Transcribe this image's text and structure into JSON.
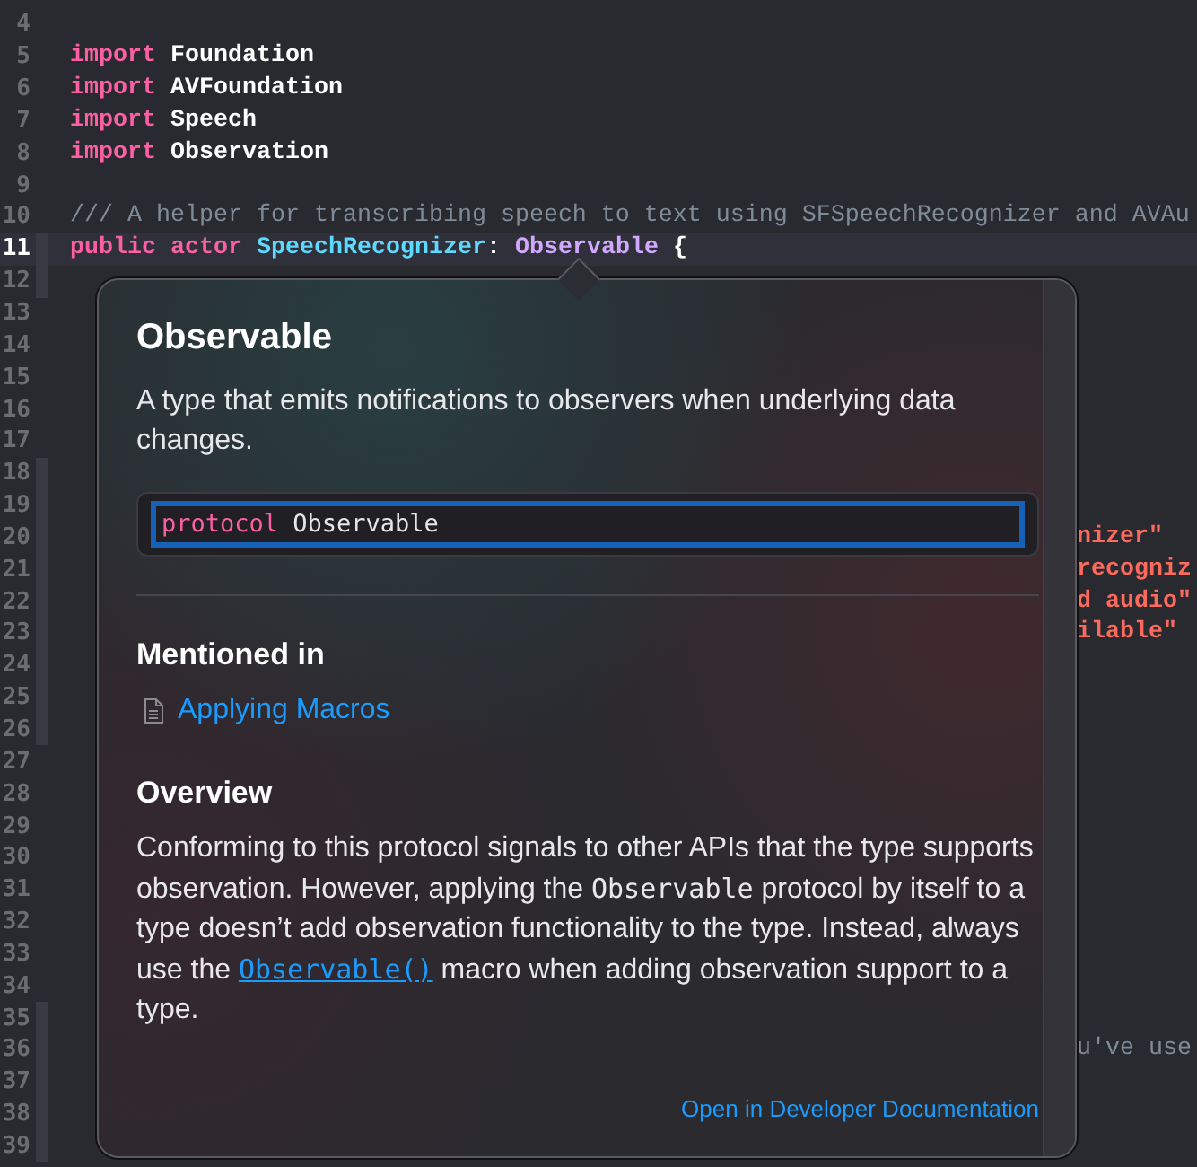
{
  "editor": {
    "lines": [
      {
        "number": "4",
        "current": false,
        "ribbon": false
      },
      {
        "number": "5",
        "current": false,
        "ribbon": false,
        "tokens": [
          {
            "kind": "keyword",
            "text": "import"
          },
          {
            "kind": "type",
            "text": " Foundation"
          }
        ]
      },
      {
        "number": "6",
        "current": false,
        "ribbon": false,
        "tokens": [
          {
            "kind": "keyword",
            "text": "import"
          },
          {
            "kind": "type",
            "text": " AVFoundation"
          }
        ]
      },
      {
        "number": "7",
        "current": false,
        "ribbon": false,
        "tokens": [
          {
            "kind": "keyword",
            "text": "import"
          },
          {
            "kind": "type",
            "text": " Speech"
          }
        ]
      },
      {
        "number": "8",
        "current": false,
        "ribbon": false,
        "tokens": [
          {
            "kind": "keyword",
            "text": "import"
          },
          {
            "kind": "type",
            "text": " Observation"
          }
        ]
      },
      {
        "number": "9",
        "current": false,
        "ribbon": false
      },
      {
        "number": "10",
        "current": false,
        "ribbon": false,
        "tokens": [
          {
            "kind": "comment",
            "text": "/// A helper for transcribing speech to text using SFSpeechRecognizer and AVAu"
          }
        ]
      },
      {
        "number": "11",
        "current": true,
        "ribbon": true,
        "tokens": [
          {
            "kind": "keyword",
            "text": "public"
          },
          {
            "kind": "keyword",
            "text": " actor"
          },
          {
            "kind": "decl",
            "text": " SpeechRecognizer"
          },
          {
            "kind": "plain",
            "text": ":"
          },
          {
            "kind": "ref",
            "text": " Observable"
          },
          {
            "kind": "plain",
            "text": " {"
          }
        ]
      },
      {
        "number": "12",
        "current": false,
        "ribbon": true
      },
      {
        "number": "13",
        "current": false,
        "ribbon": false
      },
      {
        "number": "14",
        "current": false,
        "ribbon": false
      },
      {
        "number": "15",
        "current": false,
        "ribbon": false
      },
      {
        "number": "16",
        "current": false,
        "ribbon": false
      },
      {
        "number": "17",
        "current": false,
        "ribbon": false
      },
      {
        "number": "18",
        "current": false,
        "ribbon": true
      },
      {
        "number": "19",
        "current": false,
        "ribbon": true
      },
      {
        "number": "20",
        "current": false,
        "ribbon": true,
        "tail": {
          "kind": "string",
          "text": "nizer\""
        }
      },
      {
        "number": "21",
        "current": false,
        "ribbon": true,
        "tail": {
          "kind": "string",
          "text": "recogniz"
        }
      },
      {
        "number": "22",
        "current": false,
        "ribbon": true,
        "tail": {
          "kind": "string",
          "text": "d audio\""
        }
      },
      {
        "number": "23",
        "current": false,
        "ribbon": true,
        "tail": {
          "kind": "string",
          "text": "ilable\""
        }
      },
      {
        "number": "24",
        "current": false,
        "ribbon": true
      },
      {
        "number": "25",
        "current": false,
        "ribbon": true
      },
      {
        "number": "26",
        "current": false,
        "ribbon": true
      },
      {
        "number": "27",
        "current": false,
        "ribbon": false
      },
      {
        "number": "28",
        "current": false,
        "ribbon": false
      },
      {
        "number": "29",
        "current": false,
        "ribbon": false
      },
      {
        "number": "30",
        "current": false,
        "ribbon": false
      },
      {
        "number": "31",
        "current": false,
        "ribbon": false
      },
      {
        "number": "32",
        "current": false,
        "ribbon": false
      },
      {
        "number": "33",
        "current": false,
        "ribbon": false
      },
      {
        "number": "34",
        "current": false,
        "ribbon": false
      },
      {
        "number": "35",
        "current": false,
        "ribbon": true
      },
      {
        "number": "36",
        "current": false,
        "ribbon": true,
        "tail": {
          "kind": "comment",
          "text": "u've use"
        }
      },
      {
        "number": "37",
        "current": false,
        "ribbon": true
      },
      {
        "number": "38",
        "current": false,
        "ribbon": true
      },
      {
        "number": "39",
        "current": false,
        "ribbon": true
      }
    ]
  },
  "popover": {
    "title": "Observable",
    "summary": "A type that emits notifications to observers when underlying data changes.",
    "declaration": {
      "focused": true,
      "tokens": [
        {
          "kind": "keyword",
          "text": "protocol"
        },
        {
          "kind": "plain",
          "text": " Observable"
        }
      ]
    },
    "mentioned_in": {
      "heading": "Mentioned in",
      "links": [
        "Applying Macros"
      ]
    },
    "overview": {
      "heading": "Overview",
      "runs": [
        {
          "kind": "text",
          "text": "Conforming to this protocol signals to other APIs that the type supports observation. However, applying the "
        },
        {
          "kind": "code",
          "text": "Observable"
        },
        {
          "kind": "text",
          "text": " protocol by itself to a type doesn’t add observation functionality to the type. Instead, always use the "
        },
        {
          "kind": "link",
          "text": "Observable()"
        },
        {
          "kind": "text",
          "text": " macro when adding observation support to a type."
        }
      ]
    },
    "footer_link": "Open in Developer Documentation"
  }
}
